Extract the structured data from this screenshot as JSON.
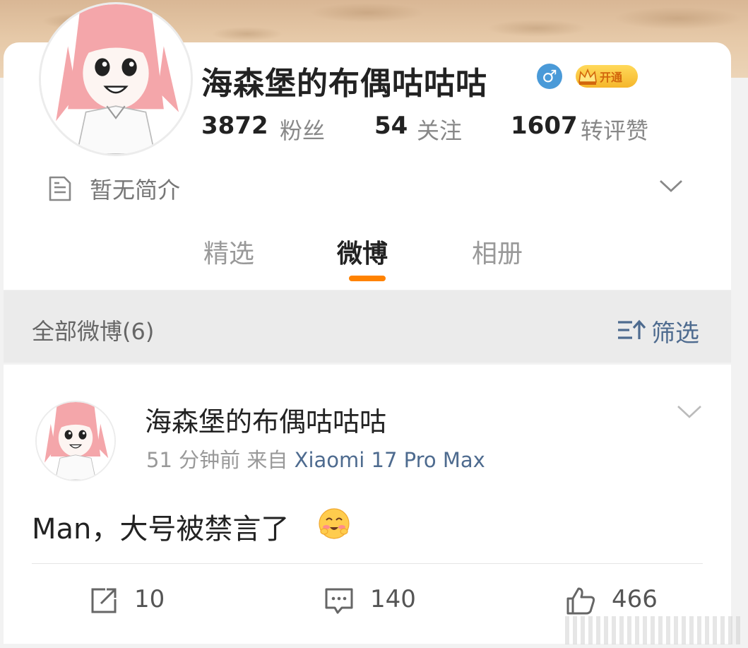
{
  "profile": {
    "username": "海森堡的布偶咕咕咕",
    "gender_icon": "male-icon",
    "gender_symbol": "♂",
    "vip_label": "开通",
    "stats": [
      {
        "count": "3872",
        "label": "粉丝"
      },
      {
        "count": "54",
        "label": "关注"
      },
      {
        "count": "1607",
        "label": "转评赞"
      }
    ],
    "intro": "暂无简介"
  },
  "tabs": [
    {
      "label": "精选",
      "active": false
    },
    {
      "label": "微博",
      "active": true
    },
    {
      "label": "相册",
      "active": false
    }
  ],
  "filter_bar": {
    "title": "全部微博(6)",
    "filter_label": "筛选"
  },
  "post": {
    "author": "海森堡的布偶咕咕咕",
    "time": "51 分钟前",
    "from_label": "来自",
    "source": "Xiaomi 17 Pro Max",
    "content": "Man，大号被禁言了",
    "emoji": "blushing-face-emoji",
    "actions": {
      "repost": "10",
      "comment": "140",
      "like": "466"
    }
  },
  "colors": {
    "accent_orange": "#ff8200",
    "link_blue": "#4e6b8f",
    "gender_blue": "#4a9ad8",
    "vip_gold": "#f5b62b"
  }
}
